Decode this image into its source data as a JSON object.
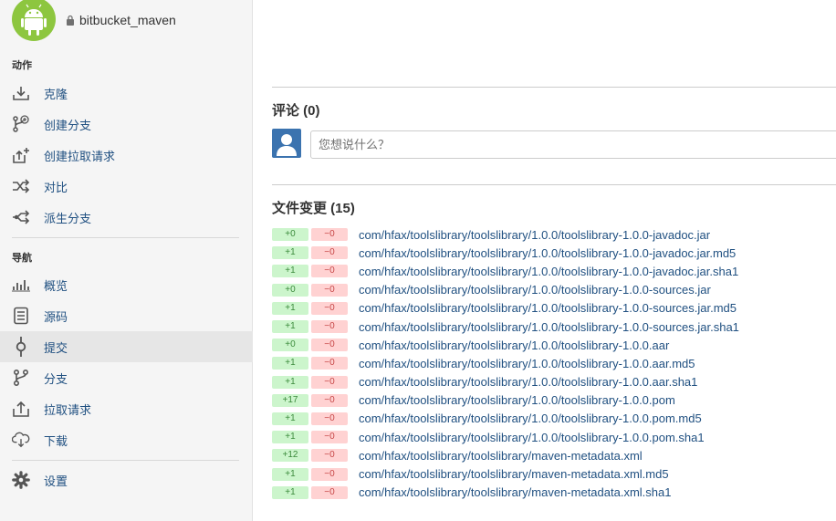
{
  "repo": {
    "name": "bitbucket_maven"
  },
  "sidebar": {
    "actions_label": "动作",
    "actions": [
      {
        "label": "克隆",
        "icon": "download-icon"
      },
      {
        "label": "创建分支",
        "icon": "create-branch-icon"
      },
      {
        "label": "创建拉取请求",
        "icon": "create-pull-request-icon"
      },
      {
        "label": "对比",
        "icon": "compare-icon"
      },
      {
        "label": "派生分支",
        "icon": "fork-icon"
      }
    ],
    "nav_label": "导航",
    "nav": [
      {
        "label": "概览",
        "icon": "overview-icon"
      },
      {
        "label": "源码",
        "icon": "source-icon"
      },
      {
        "label": "提交",
        "icon": "commits-icon",
        "active": true
      },
      {
        "label": "分支",
        "icon": "branches-icon"
      },
      {
        "label": "拉取请求",
        "icon": "pull-requests-icon"
      },
      {
        "label": "下载",
        "icon": "downloads-icon"
      }
    ],
    "settings": {
      "label": "设置",
      "icon": "gear-icon"
    }
  },
  "comments": {
    "heading": "评论 (0)",
    "placeholder": "您想说什么？"
  },
  "files": {
    "heading": "文件变更 (15)",
    "items": [
      {
        "added": "+0",
        "removed": "−0",
        "path": "com/hfax/toolslibrary/toolslibrary/1.0.0/toolslibrary-1.0.0-javadoc.jar"
      },
      {
        "added": "+1",
        "removed": "−0",
        "path": "com/hfax/toolslibrary/toolslibrary/1.0.0/toolslibrary-1.0.0-javadoc.jar.md5"
      },
      {
        "added": "+1",
        "removed": "−0",
        "path": "com/hfax/toolslibrary/toolslibrary/1.0.0/toolslibrary-1.0.0-javadoc.jar.sha1"
      },
      {
        "added": "+0",
        "removed": "−0",
        "path": "com/hfax/toolslibrary/toolslibrary/1.0.0/toolslibrary-1.0.0-sources.jar"
      },
      {
        "added": "+1",
        "removed": "−0",
        "path": "com/hfax/toolslibrary/toolslibrary/1.0.0/toolslibrary-1.0.0-sources.jar.md5"
      },
      {
        "added": "+1",
        "removed": "−0",
        "path": "com/hfax/toolslibrary/toolslibrary/1.0.0/toolslibrary-1.0.0-sources.jar.sha1"
      },
      {
        "added": "+0",
        "removed": "−0",
        "path": "com/hfax/toolslibrary/toolslibrary/1.0.0/toolslibrary-1.0.0.aar"
      },
      {
        "added": "+1",
        "removed": "−0",
        "path": "com/hfax/toolslibrary/toolslibrary/1.0.0/toolslibrary-1.0.0.aar.md5"
      },
      {
        "added": "+1",
        "removed": "−0",
        "path": "com/hfax/toolslibrary/toolslibrary/1.0.0/toolslibrary-1.0.0.aar.sha1"
      },
      {
        "added": "+17",
        "removed": "−0",
        "path": "com/hfax/toolslibrary/toolslibrary/1.0.0/toolslibrary-1.0.0.pom"
      },
      {
        "added": "+1",
        "removed": "−0",
        "path": "com/hfax/toolslibrary/toolslibrary/1.0.0/toolslibrary-1.0.0.pom.md5"
      },
      {
        "added": "+1",
        "removed": "−0",
        "path": "com/hfax/toolslibrary/toolslibrary/1.0.0/toolslibrary-1.0.0.pom.sha1"
      },
      {
        "added": "+12",
        "removed": "−0",
        "path": "com/hfax/toolslibrary/toolslibrary/maven-metadata.xml"
      },
      {
        "added": "+1",
        "removed": "−0",
        "path": "com/hfax/toolslibrary/toolslibrary/maven-metadata.xml.md5"
      },
      {
        "added": "+1",
        "removed": "−0",
        "path": "com/hfax/toolslibrary/toolslibrary/maven-metadata.xml.sha1"
      }
    ]
  },
  "colors": {
    "link": "#205081",
    "added_bg": "#ccf5cc",
    "removed_bg": "#ffd2d2",
    "avatar_green": "#8dc63f",
    "user_avatar_blue": "#3b73af"
  }
}
